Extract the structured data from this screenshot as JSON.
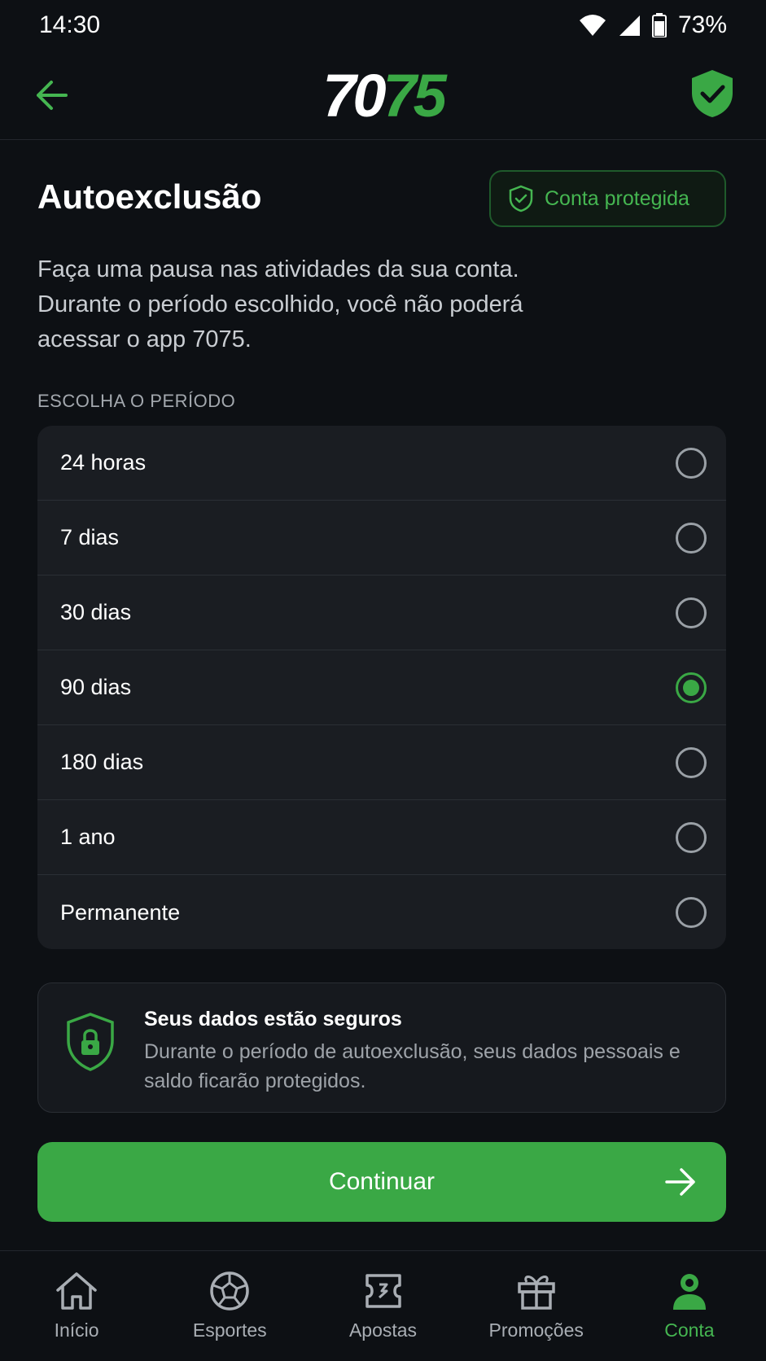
{
  "status_bar": {
    "time": "14:30",
    "battery": "73%"
  },
  "app_bar": {
    "logo_white": "70",
    "logo_green": "75"
  },
  "page": {
    "title": "Autoexclusão",
    "badge_label": "Conta protegida",
    "description": "Faça uma pausa nas atividades da sua conta. Durante o período escolhido, você não poderá acessar o app 7075.",
    "section_label": "ESCOLHA O PERÍODO"
  },
  "options": [
    {
      "label": "24 horas",
      "selected": false
    },
    {
      "label": "7 dias",
      "selected": false
    },
    {
      "label": "30 dias",
      "selected": false
    },
    {
      "label": "90 dias",
      "selected": true
    },
    {
      "label": "180 dias",
      "selected": false
    },
    {
      "label": "1 ano",
      "selected": false
    },
    {
      "label": "Permanente",
      "selected": false
    }
  ],
  "secure_card": {
    "title": "Seus dados estão seguros",
    "text": "Durante o período de autoexclusão, seus dados pessoais e saldo ficarão protegidos."
  },
  "continue_label": "Continuar",
  "nav": [
    {
      "label": "Início",
      "icon": "home-icon"
    },
    {
      "label": "Esportes",
      "icon": "soccer-ball-icon"
    },
    {
      "label": "Apostas",
      "icon": "ticket-icon"
    },
    {
      "label": "Promoções",
      "icon": "gift-icon"
    },
    {
      "label": "Conta",
      "icon": "user-icon",
      "active": true
    }
  ],
  "colors": {
    "accent": "#3aa845",
    "background": "#0d1014",
    "card": "#1a1d22"
  }
}
